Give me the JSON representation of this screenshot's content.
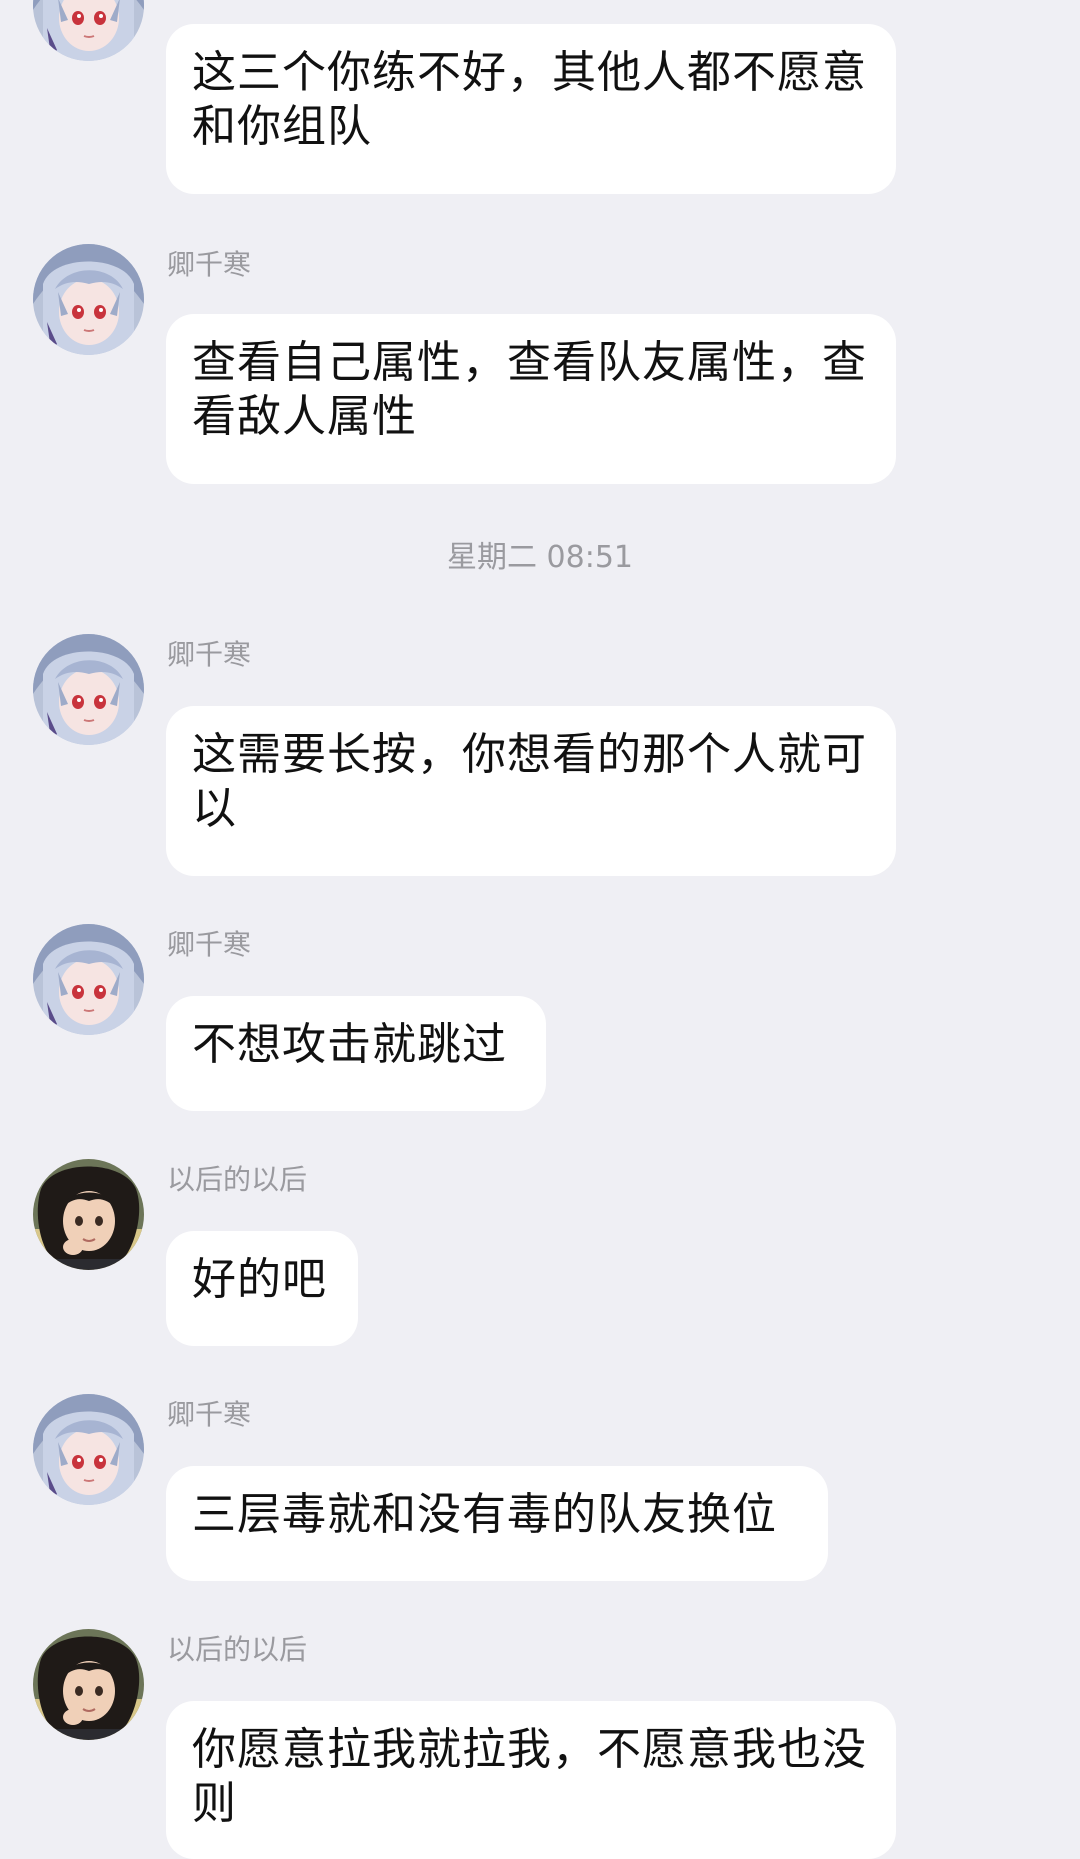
{
  "timestamp": "星期二 08:51",
  "messages": [
    {
      "sender": "",
      "avatar": "silver-hair-avatar",
      "text": "这三个你练不好，其他人都不愿意和你组队"
    },
    {
      "sender": "卿千寒",
      "avatar": "silver-hair-avatar",
      "text": "查看自己属性，查看队友属性，查看敌人属性"
    },
    {
      "sender": "卿千寒",
      "avatar": "silver-hair-avatar",
      "text": "这需要长按，你想看的那个人就可以"
    },
    {
      "sender": "卿千寒",
      "avatar": "silver-hair-avatar",
      "text": "不想攻击就跳过"
    },
    {
      "sender": "以后的以后",
      "avatar": "dark-hair-avatar",
      "text": "好的吧"
    },
    {
      "sender": "卿千寒",
      "avatar": "silver-hair-avatar",
      "text": "三层毒就和没有毒的队友换位"
    },
    {
      "sender": "以后的以后",
      "avatar": "dark-hair-avatar",
      "text": "你愿意拉我就拉我，不愿意我也没则"
    }
  ],
  "colors": {
    "background": "#efeff4",
    "bubble": "#ffffff",
    "meta_text": "#9a9a9f",
    "message_text": "#111111"
  }
}
